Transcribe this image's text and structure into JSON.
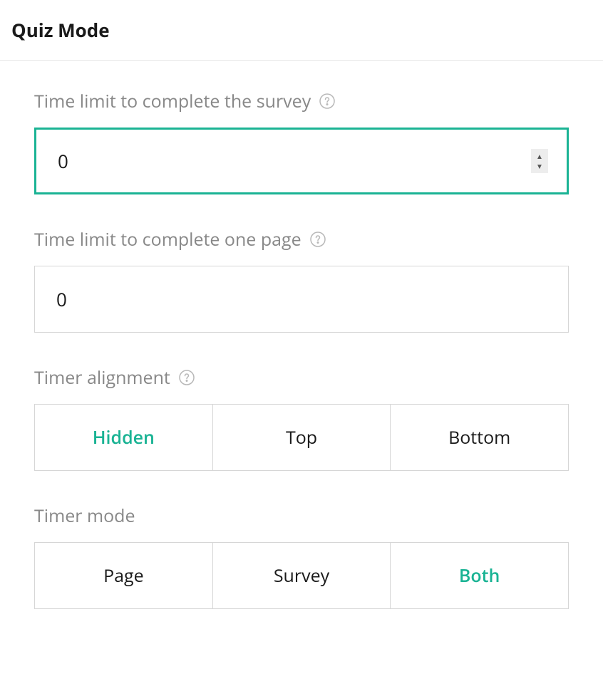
{
  "header": {
    "title": "Quiz Mode"
  },
  "fields": {
    "survey_time_limit": {
      "label": "Time limit to complete the survey",
      "value": "0"
    },
    "page_time_limit": {
      "label": "Time limit to complete one page",
      "value": "0"
    },
    "timer_alignment": {
      "label": "Timer alignment",
      "options": {
        "hidden": "Hidden",
        "top": "Top",
        "bottom": "Bottom"
      },
      "selected": "hidden"
    },
    "timer_mode": {
      "label": "Timer mode",
      "options": {
        "page": "Page",
        "survey": "Survey",
        "both": "Both"
      },
      "selected": "both"
    }
  }
}
